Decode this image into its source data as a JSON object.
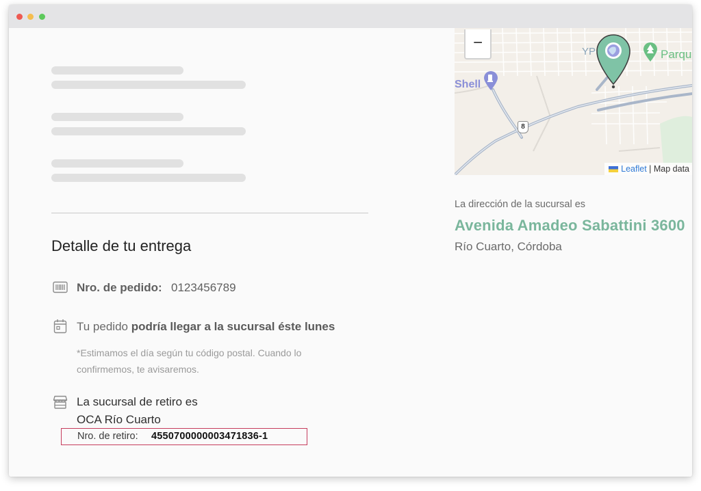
{
  "delivery": {
    "heading": "Detalle de tu entrega",
    "order_label": "Nro. de pedido:",
    "order_number": "0123456789",
    "arrival_prefix": "Tu pedido ",
    "arrival_bold": "podría llegar a la sucursal éste lunes",
    "note": "*Estimamos el día según tu código postal. Cuando lo confirmemos, te avisaremos.",
    "pickup_line1": "La sucursal de retiro es",
    "pickup_line2": "OCA Río Cuarto",
    "retiro_label": "Nro. de retiro:",
    "retiro_number": "4550700000003471836-1",
    "highlight_color": "#c63b5c"
  },
  "map": {
    "zoom_out_label": "−",
    "labels": {
      "shell": "Shell",
      "ypf": "YP",
      "park": "Parqu",
      "route": "8"
    },
    "attribution_link": "Leaflet",
    "attribution_sep": " | ",
    "attribution_text": "Map data",
    "marker_color": "#7fc3a6"
  },
  "branch": {
    "label": "La dirección de la sucursal es",
    "address": "Avenida Amadeo Sabattini 3600",
    "city": "Río Cuarto, Córdoba",
    "accent_color": "#7ab69c"
  },
  "icons": {
    "barcode": "barcode-icon",
    "calendar": "calendar-icon",
    "store": "store-icon",
    "map_pin": "map-pin-icon",
    "fuel": "fuel-station-icon",
    "tree": "park-icon"
  }
}
